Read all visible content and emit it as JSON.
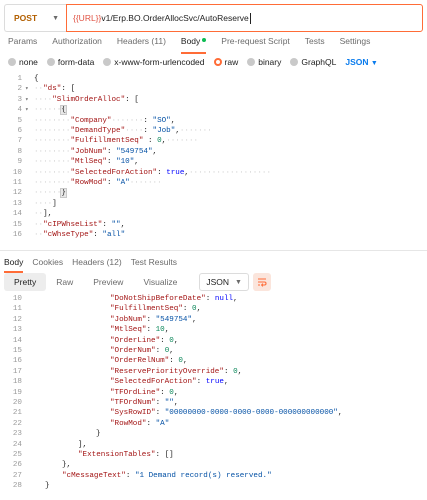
{
  "request": {
    "method": "POST",
    "url_variable": "{{URL}}",
    "url_path": "v1/Erp.BO.OrderAllocSvc/AutoReserve"
  },
  "request_tabs": [
    {
      "label": "Params",
      "active": false
    },
    {
      "label": "Authorization",
      "active": false
    },
    {
      "label": "Headers (11)",
      "active": false
    },
    {
      "label": "Body",
      "active": true
    },
    {
      "label": "Pre-request Script",
      "active": false
    },
    {
      "label": "Tests",
      "active": false
    },
    {
      "label": "Settings",
      "active": false
    }
  ],
  "body_types": {
    "options": [
      {
        "label": "none",
        "selected": false
      },
      {
        "label": "form-data",
        "selected": false
      },
      {
        "label": "x-www-form-urlencoded",
        "selected": false
      },
      {
        "label": "raw",
        "selected": true
      },
      {
        "label": "binary",
        "selected": false
      },
      {
        "label": "GraphQL",
        "selected": false
      }
    ],
    "format": "JSON"
  },
  "request_body_lines": [
    {
      "n": "1",
      "html": "<span class='p'>{</span>"
    },
    {
      "n": "2",
      "html": "<span class='ws'>··</span><span class='k'>\"ds\"</span><span class='p'>: [</span>"
    },
    {
      "n": "3",
      "html": "<span class='ws'>····</span><span class='k'>\"SlimOrderAlloc\"</span><span class='p'>: [</span>"
    },
    {
      "n": "4",
      "html": "<span class='ws'>······</span><span class='p sel'>{</span>"
    },
    {
      "n": "5",
      "html": "<span class='ws'>········</span><span class='k'>\"Company\"</span><span class='ws'>·······</span><span class='p'>: </span><span class='s'>\"SO\"</span><span class='p'>,</span>"
    },
    {
      "n": "6",
      "html": "<span class='ws'>········</span><span class='k'>\"DemandType\"</span><span class='ws'>····</span><span class='p'>: </span><span class='s'>\"Job\"</span><span class='p'>,</span><span class='ws'>·······</span>"
    },
    {
      "n": "7",
      "html": "<span class='ws'>········</span><span class='k'>\"FulfillmentSeq\"</span><span class='p'> : </span><span class='n'>0</span><span class='p'>,</span><span class='ws'>·······</span>"
    },
    {
      "n": "8",
      "html": "<span class='ws'>········</span><span class='k'>\"JobNum\"</span><span class='p'>: </span><span class='s'>\"549754\"</span><span class='p'>,</span>"
    },
    {
      "n": "9",
      "html": "<span class='ws'>········</span><span class='k'>\"MtlSeq\"</span><span class='p'>: </span><span class='s'>\"10\"</span><span class='p'>,</span>"
    },
    {
      "n": "10",
      "html": "<span class='ws'>········</span><span class='k'>\"SelectedForAction\"</span><span class='p'>: </span><span class='b'>true</span><span class='p'>,</span><span class='ws'>··················</span>"
    },
    {
      "n": "11",
      "html": "<span class='ws'>········</span><span class='k'>\"RowMod\"</span><span class='p'>: </span><span class='s'>\"A\"</span><span class='ws'>·······</span>"
    },
    {
      "n": "12",
      "html": "<span class='ws'>······</span><span class='p sel'>}</span>"
    },
    {
      "n": "13",
      "html": "<span class='ws'>····</span><span class='p'>]</span>"
    },
    {
      "n": "14",
      "html": "<span class='ws'>··</span><span class='p'>],</span>"
    },
    {
      "n": "15",
      "html": "<span class='ws'>··</span><span class='k'>\"cIPWhseList\"</span><span class='p'>: </span><span class='s'>\"\"</span><span class='p'>,</span>"
    },
    {
      "n": "16",
      "html": "<span class='ws'>··</span><span class='k'>\"cWhseType\"</span><span class='p'>: </span><span class='s'>\"all\"</span>"
    }
  ],
  "response_tabs": [
    {
      "label": "Body",
      "active": true
    },
    {
      "label": "Cookies",
      "active": false
    },
    {
      "label": "Headers (12)",
      "active": false
    },
    {
      "label": "Test Results",
      "active": false
    }
  ],
  "response_view": {
    "buttons": [
      {
        "label": "Pretty",
        "active": true
      },
      {
        "label": "Raw",
        "active": false
      },
      {
        "label": "Preview",
        "active": false
      },
      {
        "label": "Visualize",
        "active": false
      }
    ],
    "format": "JSON"
  },
  "response_body_lines": [
    {
      "n": "10",
      "html": "<span class='k'>\"DoNotShipBeforeDate\"</span><span class='p'>: </span><span class='b'>null</span><span class='p'>,</span>",
      "indent": 110
    },
    {
      "n": "11",
      "html": "<span class='k'>\"FulfillmentSeq\"</span><span class='p'>: </span><span class='n'>0</span><span class='p'>,</span>",
      "indent": 110
    },
    {
      "n": "12",
      "html": "<span class='k'>\"JobNum\"</span><span class='p'>: </span><span class='s'>\"549754\"</span><span class='p'>,</span>",
      "indent": 110
    },
    {
      "n": "13",
      "html": "<span class='k'>\"MtlSeq\"</span><span class='p'>: </span><span class='n'>10</span><span class='p'>,</span>",
      "indent": 110
    },
    {
      "n": "14",
      "html": "<span class='k'>\"OrderLine\"</span><span class='p'>: </span><span class='n'>0</span><span class='p'>,</span>",
      "indent": 110
    },
    {
      "n": "15",
      "html": "<span class='k'>\"OrderNum\"</span><span class='p'>: </span><span class='n'>0</span><span class='p'>,</span>",
      "indent": 110
    },
    {
      "n": "16",
      "html": "<span class='k'>\"OrderRelNum\"</span><span class='p'>: </span><span class='n'>0</span><span class='p'>,</span>",
      "indent": 110
    },
    {
      "n": "17",
      "html": "<span class='k'>\"ReservePriorityOverride\"</span><span class='p'>: </span><span class='n'>0</span><span class='p'>,</span>",
      "indent": 110
    },
    {
      "n": "18",
      "html": "<span class='k'>\"SelectedForAction\"</span><span class='p'>: </span><span class='b'>true</span><span class='p'>,</span>",
      "indent": 110
    },
    {
      "n": "19",
      "html": "<span class='k'>\"TFOrdLine\"</span><span class='p'>: </span><span class='n'>0</span><span class='p'>,</span>",
      "indent": 110
    },
    {
      "n": "20",
      "html": "<span class='k'>\"TFOrdNum\"</span><span class='p'>: </span><span class='s'>\"\"</span><span class='p'>,</span>",
      "indent": 110
    },
    {
      "n": "21",
      "html": "<span class='k'>\"SysRowID\"</span><span class='p'>: </span><span class='s'>\"00000000-0000-0000-0000-000000000000\"</span><span class='p'>,</span>",
      "indent": 110
    },
    {
      "n": "22",
      "html": "<span class='k'>\"RowMod\"</span><span class='p'>: </span><span class='s'>\"A\"</span>",
      "indent": 110
    },
    {
      "n": "23",
      "html": "<span class='p'>}</span>",
      "indent": 96
    },
    {
      "n": "24",
      "html": "<span class='p'>],</span>",
      "indent": 78
    },
    {
      "n": "25",
      "html": "<span class='k'>\"ExtensionTables\"</span><span class='p'>: []</span>",
      "indent": 78
    },
    {
      "n": "26",
      "html": "<span class='p'>},</span>",
      "indent": 62
    },
    {
      "n": "27",
      "html": "<span class='k'>\"cMessageText\"</span><span class='p'>: </span><span class='s'>\"1 Demand record(s) reserved.\"</span>",
      "indent": 62
    },
    {
      "n": "28",
      "html": "<span class='p'>}</span>",
      "indent": 45
    }
  ]
}
